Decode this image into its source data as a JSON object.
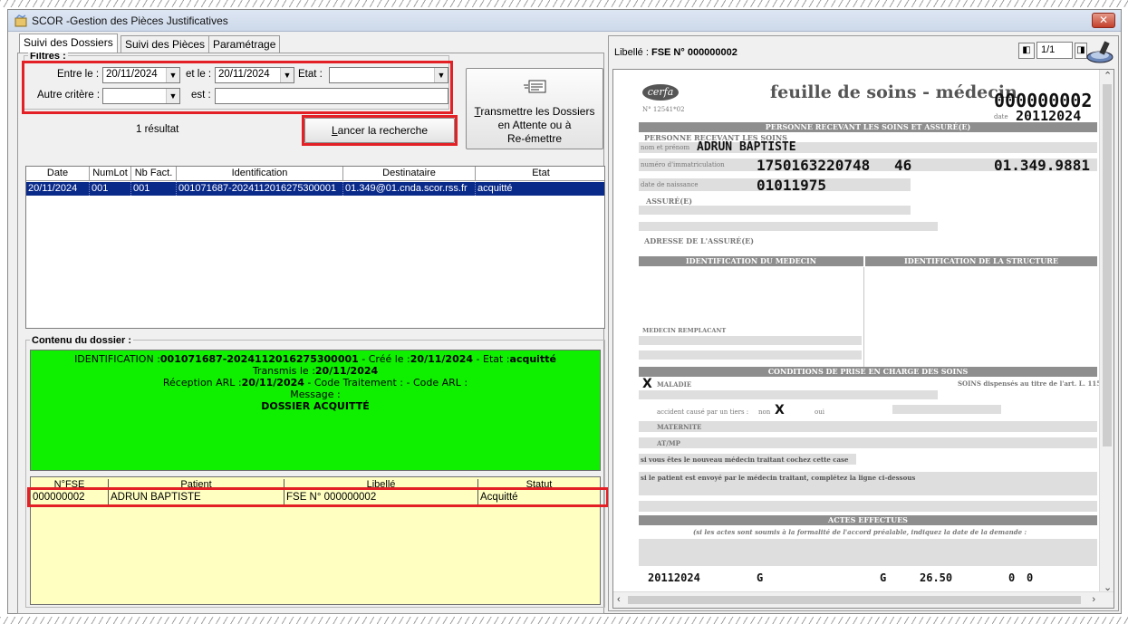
{
  "window": {
    "title": "SCOR -Gestion des Pièces Justificatives",
    "close": "✕"
  },
  "tabs": [
    {
      "label": "Suivi des Dossiers",
      "active": true
    },
    {
      "label": "Suivi des Pièces",
      "active": false
    },
    {
      "label": "Paramétrage",
      "active": false
    }
  ],
  "filters": {
    "legend": "Filtres :",
    "from_label": "Entre le :",
    "from_value": "20/11/2024",
    "to_label": "et le :",
    "to_value": "20/11/2024",
    "state_label": "Etat :",
    "state_value": "",
    "other_label": "Autre critère :",
    "other_value": "",
    "is_label": "est :",
    "is_value": ""
  },
  "result_count": "1 résultat",
  "search_button": "Lancer la recherche",
  "search_button_accel": "L",
  "transmit_button": {
    "line1_accel": "T",
    "line1": "ransmettre les Dossiers",
    "line2": "en Attente ou à",
    "line3": "Re-émettre"
  },
  "dossiers_grid": {
    "columns": [
      "Date",
      "NumLot",
      "Nb Fact.",
      "Identification",
      "Destinataire",
      "Etat"
    ],
    "rows": [
      [
        "20/11/2024",
        "001",
        "001",
        "001071687-20241120162753000​01",
        "01.349@01.cnda.scor.rss.fr",
        "acquitté"
      ]
    ]
  },
  "contenu": {
    "legend": "Contenu du dossier :",
    "id_label": "IDENTIFICATION :",
    "id_value": "001071687-20241120162753000​01",
    "created_label": " - Créé le :",
    "created_value": "20/11/2024",
    "state_label": " - Etat :",
    "state_value": "acquitté",
    "transmis_label": "Transmis le :",
    "transmis_value": "20/11/2024",
    "arl_label": "Réception ARL :",
    "arl_value": "20/11/2024",
    "arl_rest": " - Code Traitement : - Code ARL :",
    "message_label": "Message :",
    "message_value": "DOSSIER ACQUITTÉ"
  },
  "fse_grid": {
    "columns": [
      "N°FSE",
      "Patient",
      "Libellé",
      "Statut"
    ],
    "rows": [
      [
        "000000002",
        "ADRUN BAPTISTE",
        "FSE N° 000000002",
        "Acquitté"
      ]
    ]
  },
  "viewer": {
    "libelle_label": "Libellé :",
    "libelle_value": "FSE N° 000000002",
    "page": "1/1"
  },
  "document": {
    "logo": "cerfa",
    "form_number": "N° 12541*02",
    "title": "feuille de soins - médecin",
    "invoice_number": "000000002",
    "date_label": "date",
    "date": "20112024",
    "section_patient": "PERSONNE RECEVANT LES SOINS ET ASSURÉ(E)",
    "patient_row_label": "PERSONNE RECEVANT LES SOINS",
    "patient_name_label": "nom et prénom",
    "patient_name": "ADRUN BAPTISTE",
    "immatriculation_label": "numéro d'immatriculation",
    "immatriculation": "1750163220748",
    "key": "46",
    "caisse": "01.349.9881",
    "birth_label": "date de naissance",
    "birth": "01011975",
    "assure_label": "ASSURÉ(E)",
    "address_label": "ADRESSE DE L'ASSURÉ(E)",
    "ident_medecin": "IDENTIFICATION DU MEDECIN",
    "ident_structure": "IDENTIFICATION DE LA STRUCTURE",
    "medecin_remplacant": "MEDECIN REMPLACANT",
    "conditions": "CONDITIONS DE PRISE EN CHARGE DES SOINS",
    "maladie": "MALADIE",
    "soins_title": "SOINS dispensés au titre de l'art. L. 115",
    "accident_label": "accident causé par un tiers :",
    "non_label": "non",
    "oui_label": "oui",
    "maternite": "MATERNITE",
    "atmp": "AT/MP",
    "medecin_traitant_line": "si vous êtes le nouveau médecin traitant cochez cette case",
    "envoye_line": "si le patient est envoyé par le médecin traitant, complétez la ligne ci-dessous",
    "actes_effectues": "ACTES EFFECTUES",
    "actes_note": "(si les actes sont soumis à la formalité de l'accord préalable, indiquez la date de la demande :",
    "act_date": "20112024",
    "act_code": "G",
    "act_code2": "G",
    "act_amount": "26.50",
    "act_zero1": "0",
    "act_zero2": "0",
    "mark": "X"
  }
}
